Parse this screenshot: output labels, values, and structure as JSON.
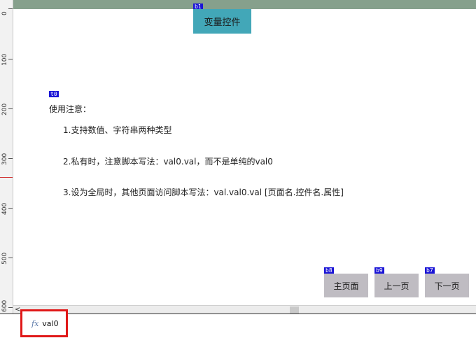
{
  "ruler": {
    "labels": [
      "0",
      "100",
      "200",
      "300",
      "400",
      "500",
      "600"
    ]
  },
  "canvas": {
    "tags": {
      "b1": "b1",
      "t0": "t0",
      "b8": "b8",
      "b9": "b9",
      "b7": "b7"
    },
    "variable_button": "变量控件",
    "notes": {
      "title": "使用注意：",
      "line1": "1.支持数值、字符串两种类型",
      "line2": "2.私有时，注意脚本写法：val0.val，而不是单纯的val0",
      "line3": "3.设为全局时，其他页面访问脚本写法：val.val0.val [页面名.控件名.属性]"
    },
    "nav": {
      "home": "主页面",
      "prev": "上一页",
      "next": "下一页"
    }
  },
  "scrollbar": {
    "left_arrow": "<"
  },
  "object_bar": {
    "icon": "fx-icon",
    "label": "val0"
  }
}
